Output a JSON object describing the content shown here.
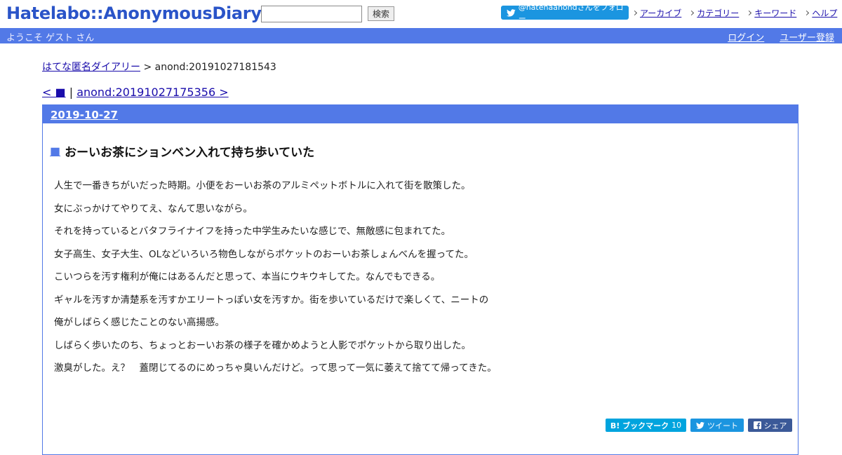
{
  "header": {
    "logo": "Hatelabo::AnonymousDiary",
    "search_button": "検索",
    "search_value": "",
    "follow_button": "@hatenaanondさんをフォロー",
    "nav": [
      {
        "label": "アーカイブ"
      },
      {
        "label": "カテゴリー"
      },
      {
        "label": "キーワード"
      },
      {
        "label": "ヘルプ"
      }
    ],
    "welcome": "ようこそ ゲスト さん",
    "login": "ログイン",
    "register": "ユーザー登録"
  },
  "breadcrumb": {
    "home": "はてな匿名ダイアリー",
    "sep": ">",
    "current": "anond:20191027181543"
  },
  "pager": {
    "prev": "< ■",
    "sep": "|",
    "next": "anond:20191027175356 >"
  },
  "entry": {
    "date": "2019-10-27",
    "title_mark": "■",
    "title": "おーいお茶にションベン入れて持ち歩いていた",
    "paragraphs": [
      "人生で一番きちがいだった時期。小便をおーいお茶のアルミペットボトルに入れて街を散策した。",
      "女にぶっかけてやりてえ、なんて思いながら。",
      "それを持っているとバタフライナイフを持った中学生みたいな感じで、無敵感に包まれてた。",
      "女子高生、女子大生、OLなどいろいろ物色しながらポケットのおーいお茶しょんべんを握ってた。",
      "こいつらを汚す権利が俺にはあるんだと思って、本当にウキウキしてた。なんでもできる。",
      "ギャルを汚すか清楚系を汚すかエリートっぽい女を汚すか。街を歩いているだけで楽しくて、ニートの",
      "俺がしばらく感じたことのない高揚感。",
      "しばらく歩いたのち、ちょっとおーいお茶の様子を確かめようと人影でポケットから取り出した。",
      "激臭がした。え？　蓋閉じてるのにめっちゃ臭いんだけど。って思って一気に萎えて捨てて帰ってきた。"
    ],
    "share": {
      "hatena_label": "B! ブックマーク",
      "hatena_count": "10",
      "tweet_label": "ツイート",
      "fb_label": "シェア"
    }
  },
  "colors": {
    "brand_blue": "#5279e7",
    "logo_blue": "#2a54c8",
    "twitter": "#1b95e0",
    "hatena": "#00a4de",
    "facebook": "#3b5998"
  }
}
